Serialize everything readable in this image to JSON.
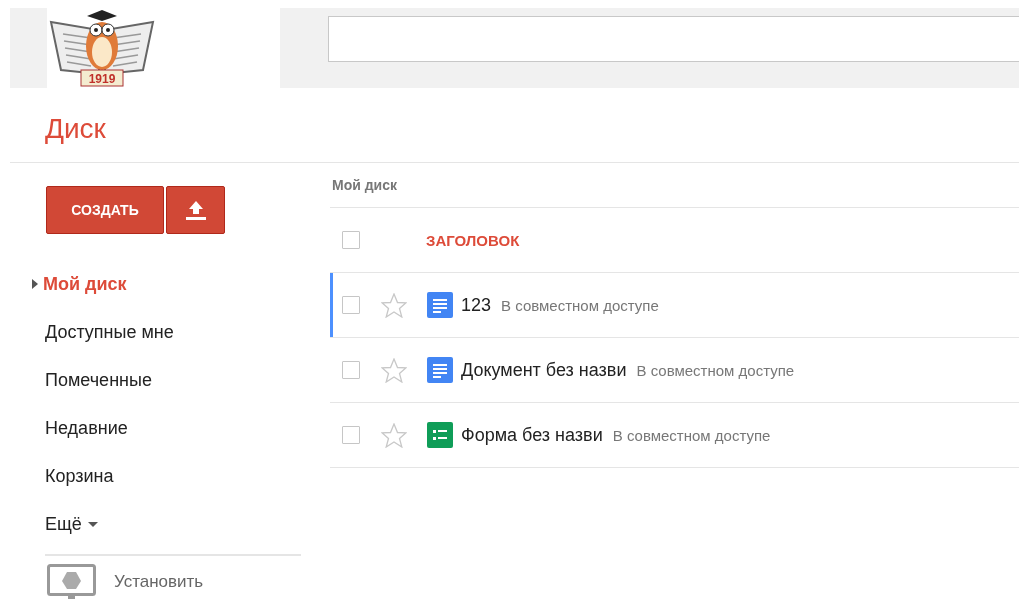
{
  "header": {
    "logo_text": "1919"
  },
  "app_title": "Диск",
  "sidebar": {
    "create_button": "СОЗДАТЬ",
    "items": [
      {
        "label": "Мой диск",
        "selected": true,
        "kind": "link"
      },
      {
        "label": "Доступные мне",
        "selected": false,
        "kind": "link"
      },
      {
        "label": "Помеченные",
        "selected": false,
        "kind": "link"
      },
      {
        "label": "Недавние",
        "selected": false,
        "kind": "link"
      },
      {
        "label": "Корзина",
        "selected": false,
        "kind": "link"
      },
      {
        "label": "Ещё",
        "selected": false,
        "kind": "dropdown"
      }
    ],
    "install": "Установить"
  },
  "breadcrumb": "Мой диск",
  "table": {
    "header": {
      "title": "ЗАГОЛОВОК",
      "checked": false
    },
    "rows": [
      {
        "kind": "doc",
        "name": "123",
        "shared": "В совместном доступе",
        "checked": false,
        "starred": false,
        "focused": true
      },
      {
        "kind": "doc",
        "name": "Документ без назви",
        "shared": "В совместном доступе",
        "checked": false,
        "starred": false,
        "focused": false
      },
      {
        "kind": "form",
        "name": "Форма без назви",
        "shared": "В совместном доступе",
        "checked": false,
        "starred": false,
        "focused": false
      }
    ]
  }
}
